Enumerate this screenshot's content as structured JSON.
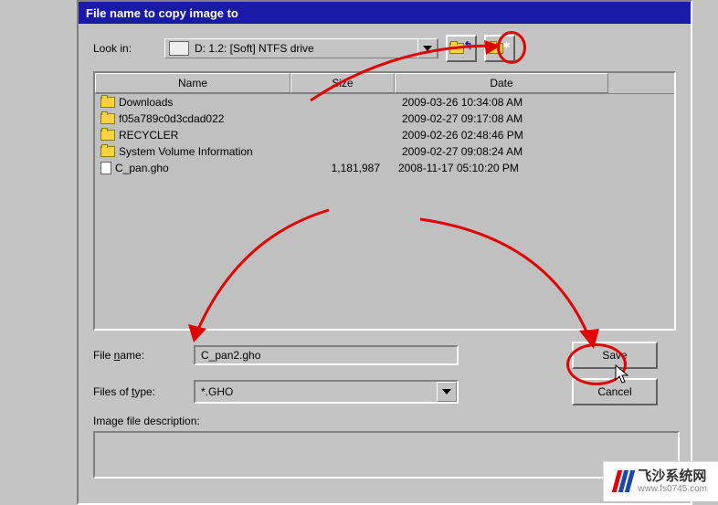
{
  "dialog": {
    "title": "File name to copy image to",
    "lookin_label": "Look in:",
    "drive_text": "D: 1.2: [Soft] NTFS drive",
    "columns": {
      "name": "Name",
      "size": "Size",
      "date": "Date"
    },
    "files": [
      {
        "icon": "folder",
        "name": "Downloads",
        "size": "",
        "date": "2009-03-26 10:34:08 AM"
      },
      {
        "icon": "folder",
        "name": "f05a789c0d3cdad022",
        "size": "",
        "date": "2009-02-27 09:17:08 AM"
      },
      {
        "icon": "folder",
        "name": "RECYCLER",
        "size": "",
        "date": "2009-02-26 02:48:46 PM"
      },
      {
        "icon": "folder",
        "name": "System Volume Information",
        "size": "",
        "date": "2009-02-27 09:08:24 AM"
      },
      {
        "icon": "file",
        "name": "C_pan.gho",
        "size": "1,181,987",
        "date": "2008-11-17 05:10:20 PM"
      }
    ],
    "filename_label": "File name:",
    "filename_value": "C_pan2.gho",
    "filetype_label": "Files of type:",
    "filetype_value": "*.GHO",
    "desc_label": "Image file description:",
    "save_label": "Save",
    "cancel_label": "Cancel"
  },
  "watermark": {
    "title": "飞沙系统网",
    "url": "www.fs0745.com"
  }
}
